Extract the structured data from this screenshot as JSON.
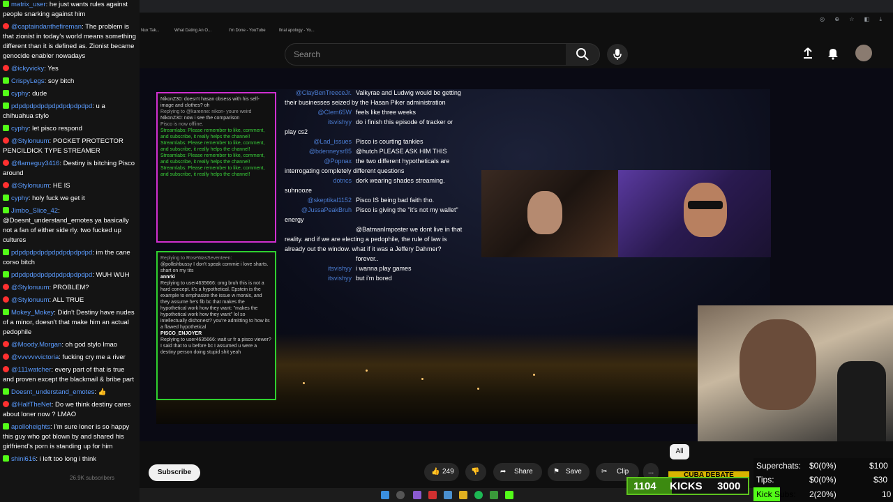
{
  "browser": {
    "bookmarks": [
      "Nux Tak...",
      "What Dating An O...",
      "I'm Done - YouTube",
      "final apology - Yo..."
    ]
  },
  "youtube": {
    "search_placeholder": "Search",
    "channel_subs": "26.9K subscribers",
    "subscribe_label": "Subscribe",
    "likes": "249",
    "share_label": "Share",
    "save_label": "Save",
    "clip_label": "Clip",
    "more_label": "...",
    "chip_all": "All"
  },
  "video_overlay": {
    "left_box_top": [
      "NikonZ30: doesn't hasan obsess with his self-image and clothes? oh",
      "Replying to @karenne: nikon- youre weird",
      "NikonZ30: now i see the comparison",
      "Pisco is now offline.",
      "Streamlabs: Please remember to like, comment, and subscribe, it really helps the channel!",
      "Streamlabs: Please remember to like, comment, and subscribe, it really helps the channel!",
      "Streamlabs: Please remember to like, comment, and subscribe, it really helps the channel!",
      "Streamlabs: Please remember to like, comment, and subscribe, it really helps the channel!"
    ],
    "left_box_bottom": [
      "Replying to RoseWasSeventeen:",
      "@pollishbussy I don't speak commie i love sharts. shart on my tits",
      "annrki",
      "Replying to user4635666: omg bruh this is not a hard concept. it's a hypothetical. Epstein is the example to emphasize the issue w morals, and they assume he's fib bc that makes the hypothetical work how they want: \"makes the hypothetical work how they want\" lol so intellectually dishonest? you're admitting to how its a flawed hypothetical",
      "PISCO_ENJOYER",
      "Replying to user4635666: wait ur fr a pisco viewer? I said that to u before bc I assumed u were a destiny person doing stupid shit yeah"
    ],
    "mid_chat": [
      {
        "user": "@ClayBenTreeceJr.",
        "msg": "Valkyrae and Ludwig would be getting their businesses seized by the Hasan Piker administration"
      },
      {
        "user": "@Clem65W",
        "msg": "feels like three weeks"
      },
      {
        "user": "itsvishyy",
        "msg": "do i finish this episode of tracker or play cs2"
      },
      {
        "user": "@Lad_issues",
        "msg": "Pisco is courting tankies"
      },
      {
        "user": "@bdenneysr85",
        "msg": "@hutch PLEASE ASK HIM THIS"
      },
      {
        "user": "@Popnax",
        "msg": "the two different hypotheticals are interrogating completely different questions"
      },
      {
        "user": "dotncs",
        "msg": "dork wearing shades streaming. suhnooze"
      },
      {
        "user": "@skeptikal1152",
        "msg": "Pisco IS being bad faith tho."
      },
      {
        "user": "@JussaPeakBruh",
        "msg": "Pisco is giving the \"it's not my wallet\" energy"
      },
      {
        "user": "",
        "msg": "@BatmanImposter we dont live in that reality. and if we are electing a pedophile, the rule of law is already out the window. what if it was a Jeffery Dahmer?"
      },
      {
        "user": "",
        "msg": "forever.."
      },
      {
        "user": "itsvishyy",
        "msg": "i wanna play games"
      },
      {
        "user": "itsvishyy",
        "msg": "but i'm bored"
      }
    ]
  },
  "chat": [
    {
      "platform": "kick",
      "user": "matrix_user",
      "color": "#5b9cff",
      "msg": "he just wants rules against people snarking against him"
    },
    {
      "platform": "yt",
      "user": "@captaindanthefireman",
      "color": "#5b9cff",
      "msg": "The problem is that zionist in today's world means something different than it is defined as. Zionist became genocide enabler nowadays"
    },
    {
      "platform": "yt",
      "user": "@ickyvicky",
      "color": "#5b9cff",
      "msg": "Yes"
    },
    {
      "platform": "kick",
      "user": "CrispyLegs",
      "color": "#5b9cff",
      "msg": "soy bitch"
    },
    {
      "platform": "kick",
      "user": "cyphy",
      "color": "#5b9cff",
      "msg": "dude"
    },
    {
      "platform": "kick",
      "user": "pdpdpdpdpdpdpdpdpdpdpd",
      "color": "#5b9cff",
      "msg": "u a chihuahua stylo"
    },
    {
      "platform": "kick",
      "user": "cyphy",
      "color": "#5b9cff",
      "msg": "let pisco respond"
    },
    {
      "platform": "yt",
      "user": "@Stylonuum",
      "color": "#5b9cff",
      "msg": "POCKET PROTECTOR PENCILDICK TYPE STREAMER"
    },
    {
      "platform": "yt",
      "user": "@flameguy3416",
      "color": "#5b9cff",
      "msg": "Destiny is bitching Pisco around"
    },
    {
      "platform": "yt",
      "user": "@Stylonuum",
      "color": "#5b9cff",
      "msg": "HE IS"
    },
    {
      "platform": "kick",
      "user": "cyphy",
      "color": "#5b9cff",
      "msg": "holy fuck we get it"
    },
    {
      "platform": "kick",
      "user": "Jimbo_Slice_42",
      "color": "#5b9cff",
      "msg": "@Doesnt_understand_emotes ya basically not a fan of either side rly. two fucked up cultures"
    },
    {
      "platform": "kick",
      "user": "pdpdpdpdpdpdpdpdpdpdpd",
      "color": "#5b9cff",
      "msg": "im the cane corso bitch"
    },
    {
      "platform": "kick",
      "user": "pdpdpdpdpdpdpdpdpdpdpd",
      "color": "#5b9cff",
      "msg": "WUH WUH"
    },
    {
      "platform": "yt",
      "user": "@Stylonuum",
      "color": "#5b9cff",
      "msg": "PROBLEM?"
    },
    {
      "platform": "yt",
      "user": "@Stylonuum",
      "color": "#5b9cff",
      "msg": "ALL TRUE"
    },
    {
      "platform": "kick",
      "user": "Mokey_Mokey",
      "color": "#5b9cff",
      "msg": "Didn't Destiny have nudes of a minor, doesn't that make him an actual pedophile"
    },
    {
      "platform": "yt",
      "user": "@Moody.Morgan",
      "color": "#5b9cff",
      "msg": "oh god stylo lmao"
    },
    {
      "platform": "yt",
      "user": "@vvvvvvvictoria",
      "color": "#5b9cff",
      "msg": "fucking cry me a river"
    },
    {
      "platform": "yt",
      "user": "@111watcher",
      "color": "#5b9cff",
      "msg": "every part of that is true and proven except the blackmail & bribe part"
    },
    {
      "platform": "kick",
      "user": "Doesnt_understand_emotes",
      "color": "#5b9cff",
      "msg": "👍"
    },
    {
      "platform": "yt",
      "user": "@HalfTheNet",
      "color": "#5b9cff",
      "msg": "Do we think destiny cares about loner now ? LMAO"
    },
    {
      "platform": "kick",
      "user": "apolloheights",
      "color": "#5b9cff",
      "msg": "I'm sure loner is so happy this guy who got blown by and shared his girlfriend's porn is standing up for him"
    },
    {
      "platform": "kick",
      "user": "shini616",
      "color": "#5b9cff",
      "msg": "i left too long i think"
    }
  ],
  "kicks_goal": {
    "current": "1104",
    "label": "KICKS",
    "target": "3000",
    "progress": 0.368
  },
  "banner_text": "CUBA DEBATE",
  "goals": {
    "superchats_label": "Superchats:",
    "superchats_value": "$0(0%)",
    "superchats_target": "$100",
    "tips_label": "Tips:",
    "tips_value": "$0(0%)",
    "tips_target": "$30",
    "subs_label": "Kick Subs:",
    "subs_value": "2(20%)",
    "subs_target": "10",
    "subs_progress": 0.2
  },
  "colors": {
    "kick_green": "#53fc18",
    "yt_red": "#ff0000",
    "chat_user": "#5b9cff"
  }
}
